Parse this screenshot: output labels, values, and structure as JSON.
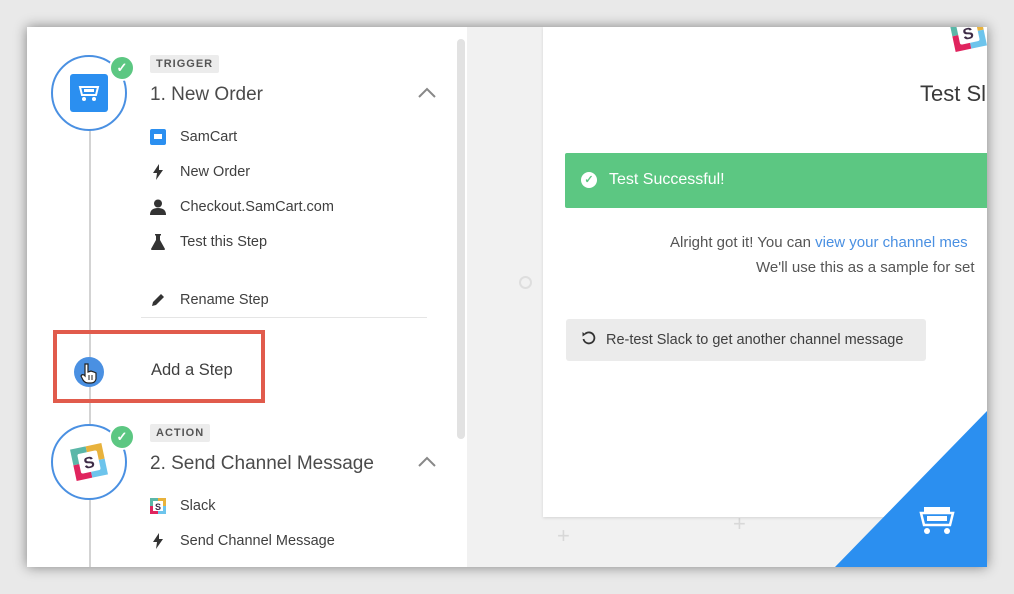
{
  "steps": [
    {
      "tag": "TRIGGER",
      "title": "1. New Order",
      "items": [
        {
          "icon": "samcart-icon",
          "label": "SamCart"
        },
        {
          "icon": "lightning-icon",
          "label": "New Order"
        },
        {
          "icon": "user-icon",
          "label": "Checkout.SamCart.com"
        },
        {
          "icon": "flask-icon",
          "label": "Test this Step"
        }
      ],
      "rename_label": "Rename Step"
    },
    {
      "tag": "ACTION",
      "title": "2. Send Channel Message",
      "items": [
        {
          "icon": "slack-icon",
          "label": "Slack"
        },
        {
          "icon": "lightning-icon",
          "label": "Send Channel Message"
        }
      ]
    }
  ],
  "add_step": {
    "label": "Add a Step"
  },
  "test_panel": {
    "heading": "Test Sl",
    "success_message": "Test Successful!",
    "message_line1_prefix": "Alright got it! You can ",
    "message_line1_link": "view your channel mes",
    "message_line2": "We'll use this as a sample for set",
    "retest_label": "Re-test Slack to get another channel message"
  },
  "colors": {
    "accent_blue": "#4a90e2",
    "success_green": "#5cc782",
    "highlight_red": "#e15b4c",
    "corner_blue": "#2b8ff0"
  }
}
